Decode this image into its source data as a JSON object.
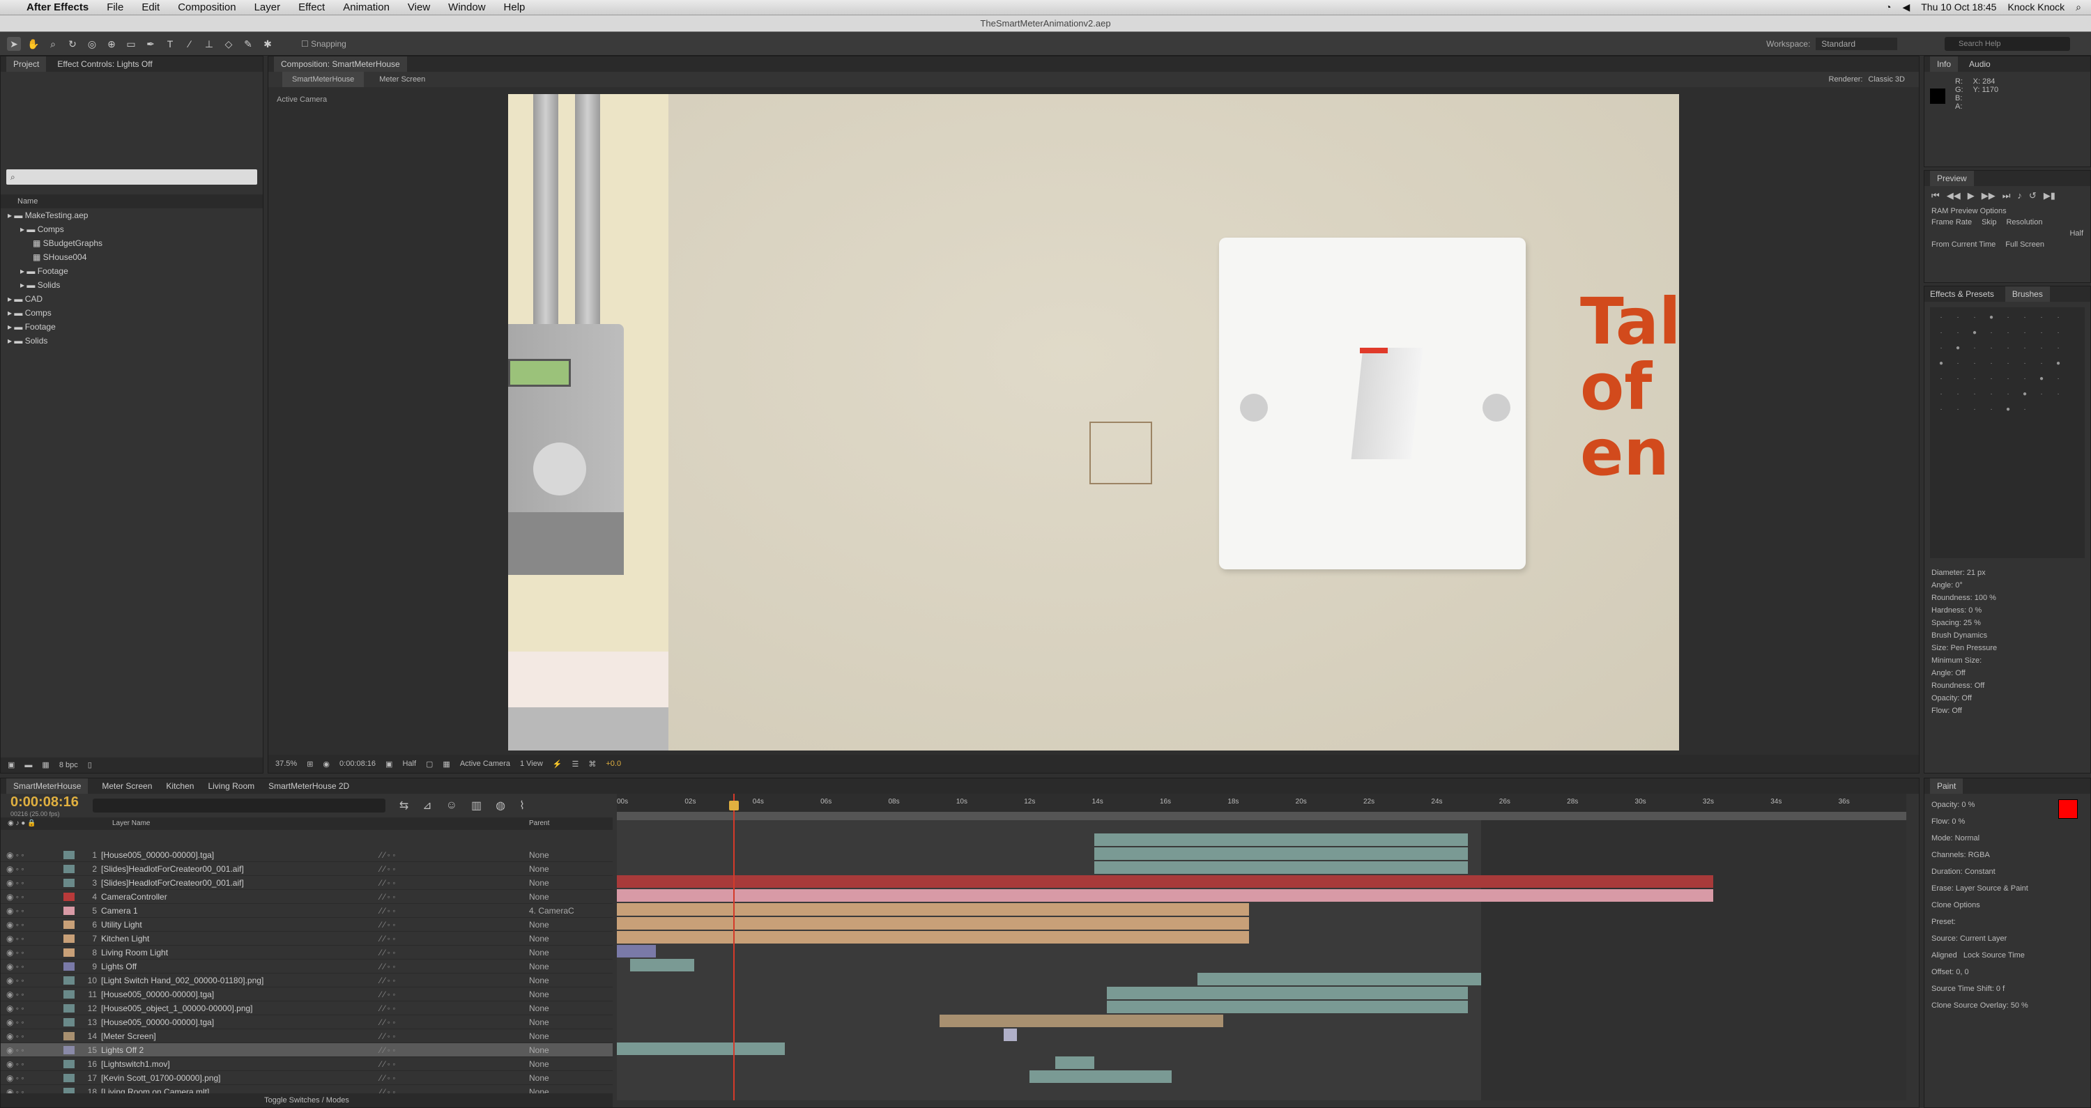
{
  "menubar": {
    "app": "After Effects",
    "items": [
      "File",
      "Edit",
      "Composition",
      "Layer",
      "Effect",
      "Animation",
      "View",
      "Window",
      "Help"
    ],
    "clock": "Thu 10 Oct 18:45",
    "user": "Knock Knock"
  },
  "document_title": "TheSmartMeterAnimationv2.aep",
  "toolbar": {
    "snapping": "Snapping",
    "workspace_label": "Workspace:",
    "workspace_value": "Standard",
    "search_placeholder": "Search Help"
  },
  "project_panel": {
    "tab": "Project",
    "effect_tab": "Effect Controls: Lights Off",
    "search_placeholder": "",
    "column_name": "Name",
    "tree": [
      {
        "label": "MakeTesting.aep",
        "depth": 0
      },
      {
        "label": "Comps",
        "depth": 1
      },
      {
        "label": "SBudgetGraphs",
        "depth": 2
      },
      {
        "label": "SHouse004",
        "depth": 2
      },
      {
        "label": "Footage",
        "depth": 1
      },
      {
        "label": "Solids",
        "depth": 1
      },
      {
        "label": "CAD",
        "depth": 0
      },
      {
        "label": "Comps",
        "depth": 0
      },
      {
        "label": "Footage",
        "depth": 0
      },
      {
        "label": "Solids",
        "depth": 0
      }
    ],
    "bpc": "8 bpc"
  },
  "comp_panel": {
    "tab": "Composition: SmartMeterHouse",
    "subtabs": [
      "SmartMeterHouse",
      "Meter Screen"
    ],
    "renderer_label": "Renderer:",
    "renderer_value": "Classic 3D",
    "camera_label": "Active Camera",
    "viewer_text": [
      "Tal",
      "of",
      "en"
    ],
    "zoom": "37.5%",
    "timecode": "0:00:08:16",
    "resolution": "Half",
    "camera": "Active Camera",
    "views": "1 View",
    "exposure": "+0.0"
  },
  "info_panel": {
    "tab": "Info",
    "audio_tab": "Audio",
    "r": "R:",
    "g": "G:",
    "b": "B:",
    "a": "A:",
    "x": "X: 284",
    "y": "Y: 1170"
  },
  "preview_panel": {
    "tab": "Preview",
    "options": "RAM Preview Options",
    "frame_rate": "Frame Rate",
    "skip": "Skip",
    "resolution": "Resolution",
    "res_value": "Half",
    "from_current": "From Current Time",
    "full_screen": "Full Screen"
  },
  "brushes_panel": {
    "tabs": [
      "Effects & Presets",
      "Brushes"
    ],
    "diameter": "Diameter: 21 px",
    "angle": "Angle: 0°",
    "roundness": "Roundness: 100 %",
    "hardness": "Hardness: 0 %",
    "spacing": "Spacing: 25 %",
    "dynamics": "Brush Dynamics",
    "size": "Size:",
    "size_value": "Pen Pressure",
    "min_size": "Minimum Size:",
    "angle2": "Angle:",
    "roundness2": "Roundness:",
    "opacity": "Opacity:",
    "flow": "Flow:",
    "off": "Off"
  },
  "paint_panel": {
    "tab": "Paint",
    "opacity": "Opacity: 0 %",
    "flow": "Flow: 0 %",
    "mode": "Mode:",
    "mode_value": "Normal",
    "channels": "Channels:",
    "channels_value": "RGBA",
    "duration": "Duration:",
    "duration_value": "Constant",
    "erase": "Erase:",
    "erase_value": "Layer Source & Paint",
    "clone": "Clone Options",
    "preset": "Preset:",
    "source": "Source:",
    "source_value": "Current Layer",
    "aligned": "Aligned",
    "lock": "Lock Source Time",
    "offset": "Offset: 0, 0",
    "source_time": "Source Time Shift: 0 f",
    "overlay": "Clone Source Overlay: 50 %",
    "fg_color": "#ff0000",
    "bg_color": "#ffffff"
  },
  "timeline": {
    "tabs": [
      "SmartMeterHouse",
      "Meter Screen",
      "Kitchen",
      "Living Room",
      "SmartMeterHouse 2D"
    ],
    "timecode": "0:00:08:16",
    "fps": "00216 (25.00 fps)",
    "col_label": "Layer Name",
    "col_parent": "Parent",
    "toggle": "Toggle Switches / Modes",
    "ruler": [
      "00s",
      "02s",
      "04s",
      "06s",
      "08s",
      "10s",
      "12s",
      "14s",
      "16s",
      "18s",
      "20s",
      "22s",
      "24s",
      "26s",
      "28s",
      "30s",
      "32s",
      "34s",
      "36s"
    ],
    "layers": [
      {
        "num": "1",
        "name": "[House005_00000-00000].tga]",
        "parent": "None",
        "color": "#6a8a8a"
      },
      {
        "num": "2",
        "name": "[Slides]HeadlotForCreateor00_001.aif]",
        "parent": "None",
        "color": "#6a8a8a"
      },
      {
        "num": "3",
        "name": "[Slides]HeadlotForCreateor00_001.aif]",
        "parent": "None",
        "color": "#6a8a8a"
      },
      {
        "num": "4",
        "name": "CameraController",
        "parent": "None",
        "color": "#b83a3a"
      },
      {
        "num": "5",
        "name": "Camera 1",
        "parent": "4. CameraC",
        "color": "#d89aa6"
      },
      {
        "num": "6",
        "name": "Utility Light",
        "parent": "None",
        "color": "#c8a078"
      },
      {
        "num": "7",
        "name": "Kitchen Light",
        "parent": "None",
        "color": "#c8a078"
      },
      {
        "num": "8",
        "name": "Living Room Light",
        "parent": "None",
        "color": "#c8a078"
      },
      {
        "num": "9",
        "name": "Lights Off",
        "parent": "None",
        "color": "#7a7aa8"
      },
      {
        "num": "10",
        "name": "[Light Switch Hand_002_00000-01180].png]",
        "parent": "None",
        "color": "#6a8a8a"
      },
      {
        "num": "11",
        "name": "[House005_00000-00000].tga]",
        "parent": "None",
        "color": "#6a8a8a"
      },
      {
        "num": "12",
        "name": "[House005_object_1_00000-00000].png]",
        "parent": "None",
        "color": "#6a8a8a"
      },
      {
        "num": "13",
        "name": "[House005_00000-00000].tga]",
        "parent": "None",
        "color": "#6a8a8a"
      },
      {
        "num": "14",
        "name": "[Meter Screen]",
        "parent": "None",
        "color": "#a89070"
      },
      {
        "num": "15",
        "name": "Lights Off 2",
        "parent": "None",
        "color": "#8a8aa8"
      },
      {
        "num": "16",
        "name": "[Lightswitch1.mov]",
        "parent": "None",
        "color": "#6a8a8a"
      },
      {
        "num": "17",
        "name": "[Kevin Scott_01700-00000].png]",
        "parent": "None",
        "color": "#6a8a8a"
      },
      {
        "num": "18",
        "name": "[Living Room on Camera.mlt]",
        "parent": "None",
        "color": "#6a8a8a"
      }
    ],
    "bars": [
      {
        "row": 0,
        "start": 0.37,
        "end": 0.66,
        "color": "#7a9a94"
      },
      {
        "row": 1,
        "start": 0.37,
        "end": 0.66,
        "color": "#7a9a94"
      },
      {
        "row": 2,
        "start": 0.37,
        "end": 0.66,
        "color": "#7a9a94"
      },
      {
        "row": 3,
        "start": 0.0,
        "end": 0.85,
        "color": "#a83a3a"
      },
      {
        "row": 4,
        "start": 0.0,
        "end": 0.85,
        "color": "#d89aa6"
      },
      {
        "row": 5,
        "start": 0.0,
        "end": 0.49,
        "color": "#c8a078"
      },
      {
        "row": 6,
        "start": 0.0,
        "end": 0.49,
        "color": "#c8a078"
      },
      {
        "row": 7,
        "start": 0.0,
        "end": 0.49,
        "color": "#c8a078"
      },
      {
        "row": 8,
        "start": 0.0,
        "end": 0.03,
        "color": "#7a7aa8"
      },
      {
        "row": 9,
        "start": 0.01,
        "end": 0.06,
        "color": "#7a9a94"
      },
      {
        "row": 10,
        "start": 0.45,
        "end": 0.67,
        "color": "#7a9a94"
      },
      {
        "row": 11,
        "start": 0.38,
        "end": 0.66,
        "color": "#7a9a94"
      },
      {
        "row": 12,
        "start": 0.38,
        "end": 0.66,
        "color": "#7a9a94"
      },
      {
        "row": 13,
        "start": 0.25,
        "end": 0.47,
        "color": "#a89070"
      },
      {
        "row": 14,
        "start": 0.3,
        "end": 0.31,
        "color": "#b0b0c8"
      },
      {
        "row": 15,
        "start": 0.0,
        "end": 0.13,
        "color": "#7a9a94"
      },
      {
        "row": 16,
        "start": 0.34,
        "end": 0.37,
        "color": "#7a9a94"
      },
      {
        "row": 17,
        "start": 0.32,
        "end": 0.43,
        "color": "#7a9a94"
      }
    ],
    "playhead_fraction": 0.09
  }
}
